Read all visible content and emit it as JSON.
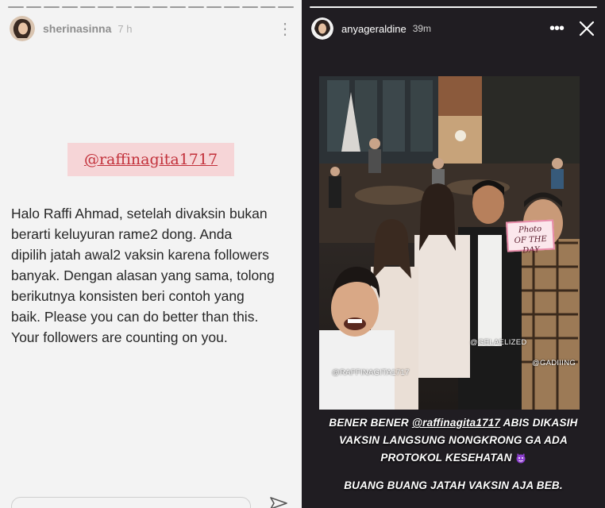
{
  "left_story": {
    "username": "sherinasinna",
    "time": "7 h",
    "mention": "@raffinagita1717",
    "text": "Halo Raffi Ahmad, setelah divaksin bukan\nberarti keluyuran rame2 dong. Anda\ndipilih jatah awal2 vaksin karena followers\nbanyak. Dengan alasan yang sama, tolong\nberikutnya konsisten beri contoh yang\nbaik. Please you can do better than this.\nYour followers are counting on you.",
    "progress_segments": 16,
    "progress_done": 16
  },
  "right_story": {
    "username": "anyageraldine",
    "time": "39m",
    "photo_sign": "Photo\nOF THE DAY",
    "tags": [
      "@GELAELIZED",
      "@RAFFINAGITA1717",
      "@GADIIING"
    ],
    "caption_line1_a": "BENER BENER ",
    "caption_mention": "@raffinagita1717",
    "caption_line1_b": " ABIS DIKASIH",
    "caption_line2": "VAKSIN LANGSUNG NONGKRONG GA ADA",
    "caption_line3": "PROTOKOL KESEHATAN",
    "caption_bottom": "BUANG BUANG JATAH VAKSIN AJA BEB.",
    "progress_segments": 1,
    "progress_done": 1
  },
  "icons": {
    "menu": "more-vertical-icon",
    "menu_right": "more-horizontal-icon",
    "close": "close-icon",
    "send": "send-icon",
    "emoji": "devil-emoji-icon"
  },
  "colors": {
    "mention_bg": "#f6d5d7",
    "mention_text": "#c2303a",
    "right_bg": "#201d22"
  }
}
